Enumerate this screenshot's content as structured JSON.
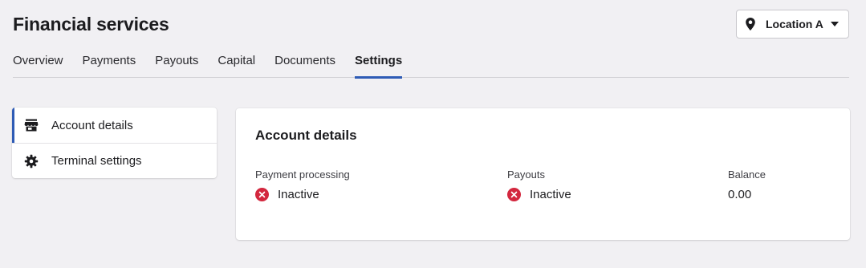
{
  "header": {
    "title": "Financial services",
    "location": {
      "label": "Location A",
      "icon": "map-pin-icon"
    }
  },
  "tabs": [
    {
      "label": "Overview",
      "active": false
    },
    {
      "label": "Payments",
      "active": false
    },
    {
      "label": "Payouts",
      "active": false
    },
    {
      "label": "Capital",
      "active": false
    },
    {
      "label": "Documents",
      "active": false
    },
    {
      "label": "Settings",
      "active": true
    }
  ],
  "sidebar": {
    "items": [
      {
        "label": "Account details",
        "icon": "storefront-icon",
        "active": true
      },
      {
        "label": "Terminal settings",
        "icon": "gear-icon",
        "active": false
      }
    ]
  },
  "account": {
    "title": "Account details",
    "fields": [
      {
        "label": "Payment processing",
        "value": "Inactive",
        "status_icon": "inactive-x-icon"
      },
      {
        "label": "Payouts",
        "value": "Inactive",
        "status_icon": "inactive-x-icon"
      },
      {
        "label": "Balance",
        "value": "0.00"
      }
    ]
  },
  "colors": {
    "accent": "#2e5bb5",
    "inactive": "#d3273e",
    "background": "#f1f0f3"
  }
}
